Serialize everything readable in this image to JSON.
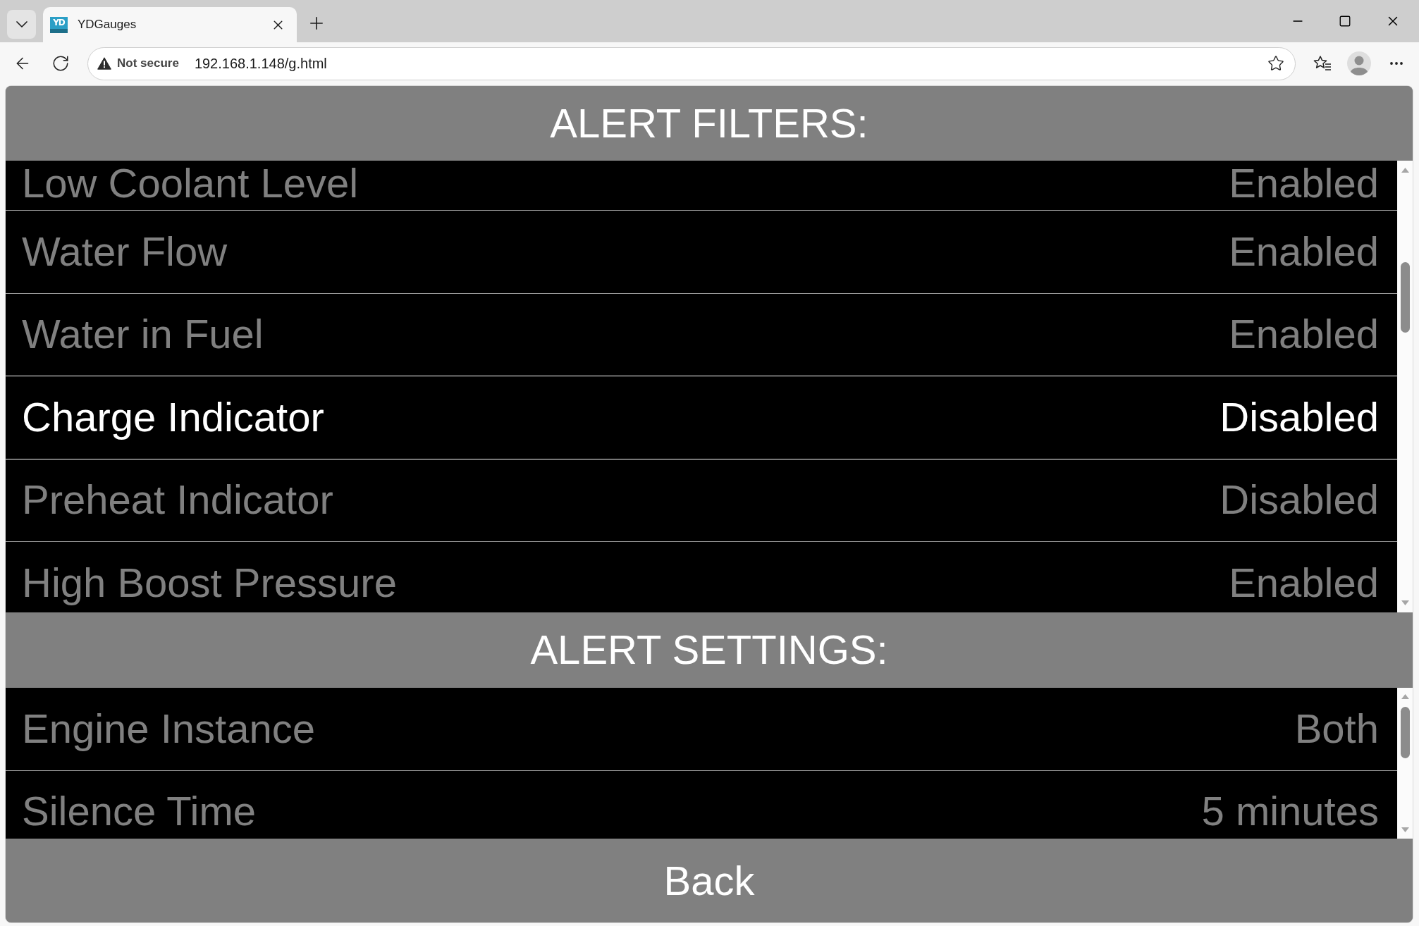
{
  "tabs": [
    {
      "favicon": "YD",
      "title": "YDGauges",
      "selected": true
    }
  ],
  "address_bar": {
    "security": "Not secure",
    "url": "192.168.1.148/g.html"
  },
  "alert_filters": {
    "title": "ALERT FILTERS:",
    "items": [
      {
        "label": "Low Coolant Level",
        "value": "Enabled",
        "selected": false
      },
      {
        "label": "Water Flow",
        "value": "Enabled",
        "selected": false
      },
      {
        "label": "Water in Fuel",
        "value": "Enabled",
        "selected": false
      },
      {
        "label": "Charge Indicator",
        "value": "Disabled",
        "selected": true
      },
      {
        "label": "Preheat Indicator",
        "value": "Disabled",
        "selected": false
      },
      {
        "label": "High Boost Pressure",
        "value": "Enabled",
        "selected": false
      }
    ]
  },
  "alert_settings": {
    "title": "ALERT SETTINGS:",
    "items": [
      {
        "label": "Engine Instance",
        "value": "Both",
        "selected": false
      },
      {
        "label": "Silence Time",
        "value": "5 minutes",
        "selected": false
      }
    ]
  },
  "back_button": "Back"
}
